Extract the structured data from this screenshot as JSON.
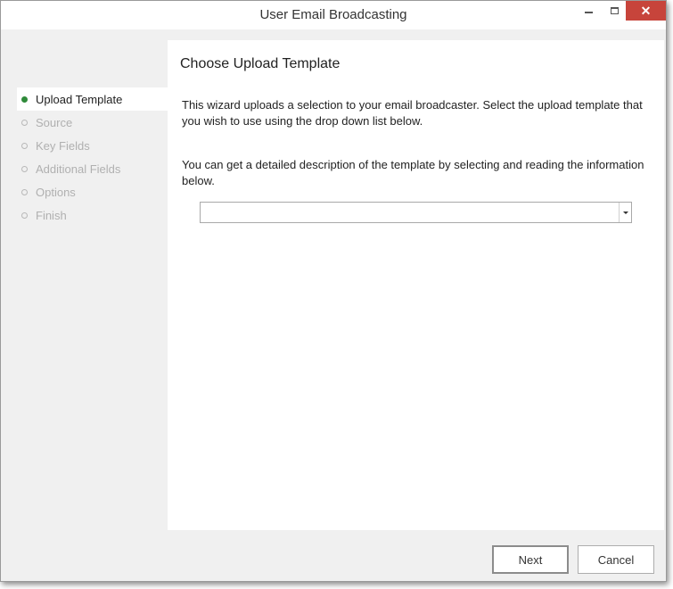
{
  "window": {
    "title": "User Email Broadcasting",
    "close_glyph": "✕"
  },
  "sidebar": {
    "items": [
      {
        "label": "Upload Template",
        "state": "active"
      },
      {
        "label": "Source",
        "state": "inactive"
      },
      {
        "label": "Key Fields",
        "state": "inactive"
      },
      {
        "label": "Additional Fields",
        "state": "inactive"
      },
      {
        "label": "Options",
        "state": "inactive"
      },
      {
        "label": "Finish",
        "state": "inactive"
      }
    ]
  },
  "page": {
    "heading": "Choose Upload Template",
    "paragraph1": "This wizard uploads a selection to your email broadcaster.  Select the upload template that you wish to use using the drop down list below.",
    "paragraph2": "You can get a detailed description of the template by selecting and reading the information below.",
    "template_select": {
      "value": ""
    }
  },
  "footer": {
    "next_label": "Next",
    "cancel_label": "Cancel"
  },
  "colors": {
    "active_dot": "#2f8a3a",
    "close_button": "#c7443b",
    "inactive_text": "#b0b0b0"
  },
  "icons": {
    "active_step": "filled-dot-icon",
    "inactive_step": "hollow-dot-icon",
    "dropdown": "chevron-down-icon"
  }
}
